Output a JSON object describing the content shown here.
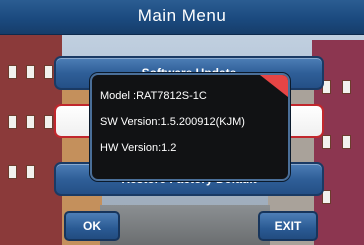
{
  "header": {
    "title": "Main Menu"
  },
  "menu": {
    "items": [
      {
        "label": "Software Update",
        "state": "normal"
      },
      {
        "label": "",
        "state": "selected"
      },
      {
        "label": "Restore Factory Default",
        "state": "normal"
      }
    ]
  },
  "info_popup": {
    "model": "Model :RAT7812S-1C",
    "sw_version": "SW Version:1.5.200912(KJM)",
    "hw_version": "HW Version:1.2"
  },
  "footer": {
    "ok_label": "OK",
    "exit_label": "EXIT"
  },
  "colors": {
    "accent_blue": "#2f5f98",
    "selection_red": "#c1272d",
    "popup_corner_red": "#e64545",
    "popup_bg": "#111214"
  }
}
